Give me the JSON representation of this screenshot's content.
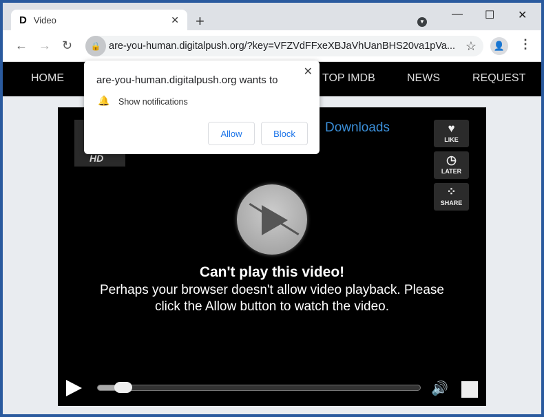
{
  "browser": {
    "tab_title": "Video",
    "tab_favicon": "D",
    "url": "are-you-human.digitalpush.org/?key=VFZVdFFxeXBJaVhUanBHS20va1pVa..."
  },
  "site_nav": [
    "HOME",
    "TOP IMDB",
    "NEWS",
    "REQUEST"
  ],
  "video": {
    "hd_label": "HD",
    "downloads_link": "Downloads",
    "side_buttons": [
      "LIKE",
      "LATER",
      "SHARE"
    ],
    "heading": "Can't play this video!",
    "message": "Perhaps your browser doesn't allow video playback. Please click the Allow button to watch the video.",
    "progress_fraction": 0.05
  },
  "permission_popup": {
    "title": "are-you-human.digitalpush.org wants to",
    "permission": "Show notifications",
    "allow_label": "Allow",
    "block_label": "Block"
  }
}
